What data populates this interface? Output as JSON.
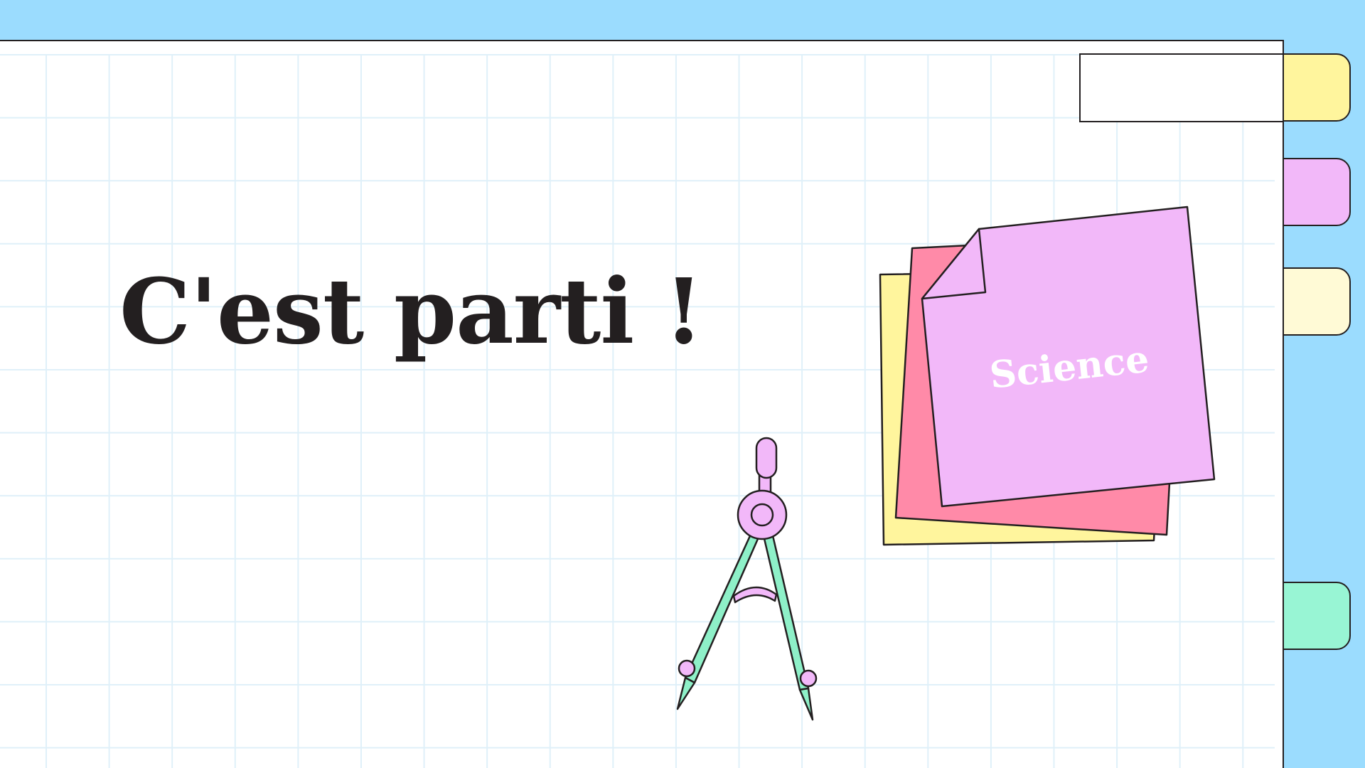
{
  "slide": {
    "title": "C'est parti !",
    "sticky_note_label": "Science"
  },
  "colors": {
    "background": "#9bdcfe",
    "paper": "#ffffff",
    "grid_line": "#dff0f9",
    "outline": "#231f20",
    "tab_yellow": "#fff59d",
    "tab_purple": "#f2b8f9",
    "tab_cream": "#fffad6",
    "tab_green": "#98f5d4",
    "note_yellow": "#fff59d",
    "note_pink": "#ff8aa8",
    "note_purple": "#f2b8f9",
    "compass_green": "#8ef0c8",
    "compass_pink": "#f2b8f9"
  },
  "icons": [
    "compass-icon",
    "sticky-notes-icon",
    "notebook-tab"
  ]
}
